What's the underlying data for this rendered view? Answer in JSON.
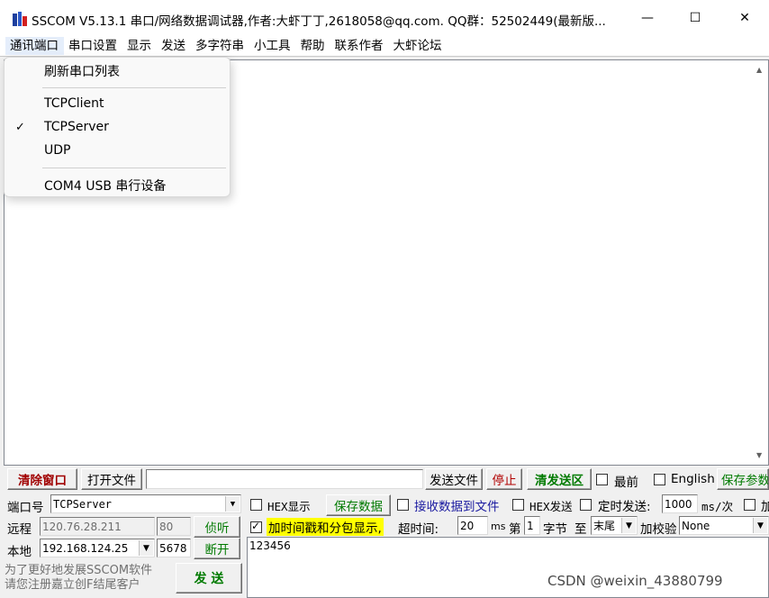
{
  "window": {
    "title": "SSCOM V5.13.1 串口/网络数据调试器,作者:大虾丁丁,2618058@qq.com. QQ群：52502449(最新版...",
    "minimize": "—",
    "maximize": "☐",
    "close": "✕"
  },
  "menu": [
    "通讯端口",
    "串口设置",
    "显示",
    "发送",
    "多字符串",
    "小工具",
    "帮助",
    "联系作者",
    "大虾论坛"
  ],
  "dropdown": {
    "refresh": "刷新串口列表",
    "tcp_client": "TCPClient",
    "tcp_server": "TCPServer",
    "check": "✓",
    "udp": "UDP",
    "com": "COM4 USB 串行设备"
  },
  "toolbar": {
    "clear_window": "清除窗口",
    "open_file": "打开文件",
    "file_path": "",
    "send_file": "发送文件",
    "stop": "停止",
    "clear_send": "清发送区",
    "topmost": "最前",
    "english": "English",
    "save_params": "保存参数"
  },
  "port": {
    "port_label": "端口号",
    "port_value": "TCPServer",
    "remote_label": "远程",
    "remote_ip": "120.76.28.211",
    "remote_port": "80",
    "listen": "侦听",
    "local_label": "本地",
    "local_ip": "192.168.124.25",
    "local_port": "5678",
    "disconnect": "断开"
  },
  "options": {
    "hex_display": "HEX显示",
    "save_data": "保存数据",
    "recv_to_file": "接收数据到文件",
    "hex_send": "HEX发送",
    "timed_send": "定时发送:",
    "interval": "1000",
    "interval_unit": "ms/次",
    "add": "加",
    "timestamp": "加时间戳和分包显示,",
    "timeout_label": "超时间:",
    "timeout_value": "20",
    "timeout_unit": "ms",
    "di": "第",
    "byte_index": "1",
    "byte_label": "字节",
    "to": "至",
    "end_value": "末尾",
    "checksum_label": "加校验",
    "checksum_value": "None"
  },
  "send": {
    "text": "123456",
    "button": "发  送"
  },
  "promo": [
    "为了更好地发展SSCOM软件",
    "请您注册嘉立创F结尾客户"
  ],
  "watermark": "CSDN @weixin_43880799",
  "icons": {
    "combo_arrow": "▼",
    "scroll_up": "▲",
    "scroll_down": "▼"
  }
}
